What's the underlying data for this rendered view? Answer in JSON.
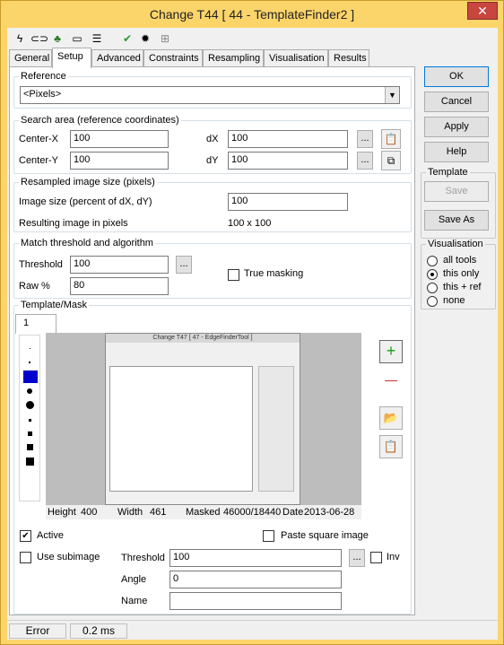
{
  "window": {
    "title": "Change T44 [ 44 - TemplateFinder2 ]",
    "close_glyph": "✕"
  },
  "toolbar": {
    "icons": [
      "lightning-icon",
      "link-icon",
      "frog-icon",
      "console-icon",
      "list-icon",
      "check-icon",
      "bug-icon",
      "grid-icon"
    ]
  },
  "tabs": [
    "General",
    "Setup",
    "Advanced",
    "Constraints",
    "Resampling",
    "Visualisation",
    "Results"
  ],
  "active_tab": "Setup",
  "reference": {
    "label": "Reference",
    "value": "<Pixels>"
  },
  "search_area": {
    "label": "Search area (reference coordinates)",
    "center_x_label": "Center-X",
    "center_x": "100",
    "center_y_label": "Center-Y",
    "center_y": "100",
    "dx_label": "dX",
    "dx": "100",
    "dy_label": "dY",
    "dy": "100",
    "ellipsis": "..."
  },
  "resampled": {
    "label": "Resampled image size (pixels)",
    "image_size_label": "Image size (percent of dX, dY)",
    "image_size": "100",
    "result_label": "Resulting image in pixels",
    "result": "100 x 100"
  },
  "match": {
    "label": "Match threshold and algorithm",
    "threshold_label": "Threshold",
    "threshold": "100",
    "raw_label": "Raw %",
    "raw": "80",
    "true_masking_label": "True masking",
    "ellipsis": "..."
  },
  "template_mask": {
    "label": "Template/Mask",
    "subtab": "1",
    "info": {
      "height_label": "Height",
      "height": "400",
      "width_label": "Width",
      "width": "461",
      "masked_label": "Masked",
      "masked": "46000/18440",
      "date_label": "Date",
      "date": "2013-06-28"
    },
    "active_label": "Active",
    "paste_square_label": "Paste square image",
    "use_subimage_label": "Use subimage",
    "threshold_label": "Threshold",
    "threshold": "100",
    "inv_label": "Inv",
    "angle_label": "Angle",
    "angle": "0",
    "name_label": "Name",
    "name": "",
    "ellipsis": "...",
    "add_glyph": "+",
    "remove_glyph": "—",
    "open_glyph": "📂",
    "paste_glyph": "📋"
  },
  "side": {
    "ok": "OK",
    "cancel": "Cancel",
    "apply": "Apply",
    "help": "Help",
    "template_label": "Template",
    "save": "Save",
    "save_as": "Save As",
    "visualisation_label": "Visualisation",
    "vis_options": [
      "all tools",
      "this only",
      "this + ref",
      "none"
    ],
    "vis_selected": "this only"
  },
  "status": {
    "state": "Error",
    "time": "0.2 ms"
  },
  "preview_mini_title": "Change T47 [ 47 - EdgeFinderTool ]",
  "colors": {
    "title_bar": "#fbd46a",
    "close": "#c7463f",
    "brush_selected": "#0000cc"
  }
}
